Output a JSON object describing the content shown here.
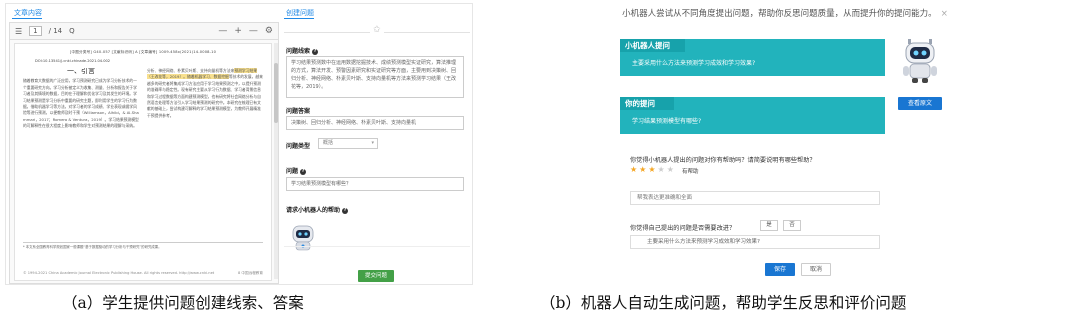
{
  "panel_a": {
    "tab_label": "文章内容",
    "form_tab_label": "创建问题",
    "toolbar": {
      "page_current": "1",
      "page_total": "/ 14",
      "search_glyph": "Q",
      "zoom_out": "—",
      "zoom_in": "+",
      "more": "—",
      "settings_glyph": "⚙"
    },
    "paper": {
      "meta": "[中图分类号] G40-057   [文献标识码] A   [文章编号] 1009-458x(2021)14-0008-10",
      "doi": "DOI:10.13541/j.cnki.chinade.2021.04.002",
      "section_title": "一、引言",
      "col_left": "随着教育大数据的广泛应用，学习预测研究已成为学习分析技术的一个重要研究方向。学习分析被定义为收集、测量、分析和报告关于学习者及其情境的数据，目的在于理解和优化学习及其发生的环境。学习结果预测是学习分析中重要的研究主题，即利用学生的学习行为数据，借助机器学习等方法，对学习者的学习成绩、学业表现或辍学风险等进行预测，以便教师及时干预（Williamson，Alhibi，& Al-Shammari，2017；Romero & Ventura，2019）。学习结果预测模型的可解释性在很大程度上影响教师和学生对预测结果的理解与采纳。",
      "col_right_pre": "分析、神经网络、朴素贝叶斯、支持向量机等方法来",
      "col_right_highlight": "预测学习结果（王改花等，2019）。随着机器学习、数据挖掘",
      "col_right_post": "等技术的发展，越来越多的研究者将集成学习方法应用于学习结果预测之中，以提升预测的准确率与稳定性。现有研究主要从学习行为数据、学习者背景信息和学习过程数据等方面构建预测模型，也有研究将社会网络分析与自然语言处理等方法引入学习结果预测的研究中。本研究在梳理已有文献的基础上，尝试构建可解释的学习结果预测模型，为教师开展精准干预提供参考。",
      "footnote": "* 本文系全国教育科学规划国家一般课题“基于数据驱动的学习分析与干预研究”的研究成果。",
      "footer_left": "© 1994-2021 China Academic Journal Electronic Publishing House. All rights reserved.  http://www.cnki.net",
      "footer_right": "8  中国远程教育"
    },
    "form": {
      "star_glyph": "✩",
      "clue_label": "问题线索",
      "clue_text": "学习结果预测数中在运用数据挖掘技术、成绩预测模型实证研究，算法推理的方式，算法开发、预警因素研究和实证研究等方面，主要用到决策树、回归分析、神经网络、朴素贝叶斯、支持向量机等方法来预测学习结果（王改花等，2019）。",
      "answer_label": "问题答案",
      "answer_text": "决策树、回归分析、神经网络、朴素贝叶斯、支持向量机",
      "type_label": "问题类型",
      "type_value": "概括",
      "question_label": "问题",
      "question_text": "学习结果预测模型有哪些？",
      "help_label": "请求小机器人的帮助",
      "submit_label": "提交问题"
    }
  },
  "panel_b": {
    "title": "小机器人尝试从不同角度提出问题，帮助你反思问题质量，从而提升你的提问能力。",
    "close_glyph": "×",
    "robot_q_header": "小机器人提问",
    "robot_q_text": "主要采用什么方法来预测学习成效和学习效果?",
    "my_q_header": "你的提问",
    "my_q_text": "学习结果预测模型有哪些?",
    "view_button": "查看原文",
    "q1": "你觉得小机器人提出的问题对你有帮助吗？请简要说明有哪些帮助？",
    "rating": 3,
    "rating_max": 5,
    "rating_text": "有帮助",
    "answer1": "帮我表达更准确和全面",
    "q2": "你觉得自己提出的问题是否需要改进？",
    "yes_label": "是",
    "no_label": "否",
    "answer2": "主要采用什么方法来预测学习成效和学习效果?",
    "save_label": "保存",
    "cancel_label": "取消"
  },
  "captions": {
    "a": "（a）学生提供问题创建线索、答案",
    "b": "（b）机器人自动生成问题，帮助学生反思和评价问题"
  },
  "colors": {
    "accent_blue": "#1976d2",
    "teal": "#22b3bc",
    "submit_green": "#43a047",
    "star_gold": "#f5a623"
  }
}
